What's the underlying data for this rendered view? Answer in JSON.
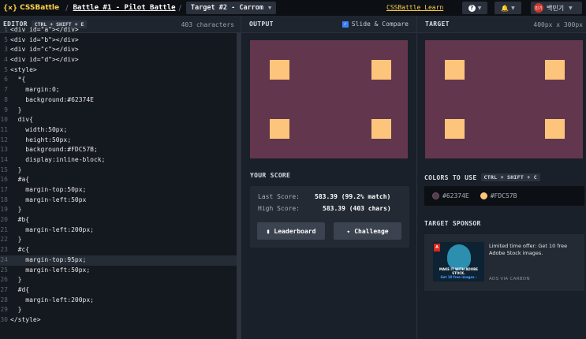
{
  "header": {
    "logo_mark": "{×}",
    "logo_text": "CSSBattle",
    "breadcrumb_sep": "/",
    "battle_link": "Battle #1 - Pilot Battle",
    "target_select": "Target #2 - Carrom",
    "learn_link": "CSSBattle Learn",
    "help_icon": "?",
    "bell_icon": "🔔",
    "user_name": "백민기",
    "avatar_text": "민기"
  },
  "editor": {
    "title": "EDITOR",
    "shortcut": "CTRL + SHIFT + E",
    "char_count": "403 characters",
    "lines": [
      {
        "n": "1",
        "text": "<div id=\"a\"></div>"
      },
      {
        "n": "5",
        "text": "<div id=\"b\"></div>"
      },
      {
        "n": "3",
        "text": "<div id=\"c\"></div>"
      },
      {
        "n": "4",
        "text": "<div id=\"d\"></div>"
      },
      {
        "n": "5",
        "text": "<style>"
      },
      {
        "n": "6",
        "text": "  *{"
      },
      {
        "n": "7",
        "text": "    margin:0;"
      },
      {
        "n": "8",
        "text": "    background:#62374E"
      },
      {
        "n": "9",
        "text": "  }"
      },
      {
        "n": "10",
        "text": "  div{"
      },
      {
        "n": "11",
        "text": "    width:50px;"
      },
      {
        "n": "12",
        "text": "    height:50px;"
      },
      {
        "n": "13",
        "text": "    background:#FDC57B;"
      },
      {
        "n": "14",
        "text": "    display:inline-block;"
      },
      {
        "n": "15",
        "text": "  }"
      },
      {
        "n": "16",
        "text": "  #a{"
      },
      {
        "n": "17",
        "text": "    margin-top:50px;"
      },
      {
        "n": "18",
        "text": "    margin-left:50px"
      },
      {
        "n": "19",
        "text": "  }"
      },
      {
        "n": "20",
        "text": "  #b{"
      },
      {
        "n": "21",
        "text": "    margin-left:200px;"
      },
      {
        "n": "22",
        "text": "  }"
      },
      {
        "n": "23",
        "text": "  #c{"
      },
      {
        "n": "24",
        "text": "    margin-top:95px;"
      },
      {
        "n": "25",
        "text": "    margin-left:50px;"
      },
      {
        "n": "26",
        "text": "  }"
      },
      {
        "n": "27",
        "text": "  #d{"
      },
      {
        "n": "28",
        "text": "    margin-left:200px;"
      },
      {
        "n": "29",
        "text": "  }"
      },
      {
        "n": "30",
        "text": "</style>"
      }
    ]
  },
  "output": {
    "title": "OUTPUT",
    "slide_label": "Slide & Compare",
    "slide_checked": true
  },
  "score": {
    "title": "YOUR SCORE",
    "last_label": "Last Score:",
    "last_value": "583.39 (99.2% match)",
    "high_label": "High Score:",
    "high_value": "583.39 (403 chars)",
    "leaderboard_label": "Leaderboard",
    "challenge_label": "Challenge"
  },
  "target": {
    "title": "TARGET",
    "size": "400px x 300px"
  },
  "colors": {
    "title": "COLORS TO USE",
    "shortcut": "CTRL + SHIFT + C",
    "background": "#62374E",
    "foreground": "#FDC57B",
    "bg_label": "#62374E",
    "fg_label": "#FDC57B"
  },
  "sponsor": {
    "title": "TARGET SPONSOR",
    "ad_text": "Limited time offer: Get 10 free Adobe Stock images.",
    "ad_via": "ADS VIA CARBON",
    "ad_caption": "MAKE IT WITH ADOBE STOCK.",
    "ad_caption2": "Get 10 free images ›",
    "ad_logo": "A"
  }
}
